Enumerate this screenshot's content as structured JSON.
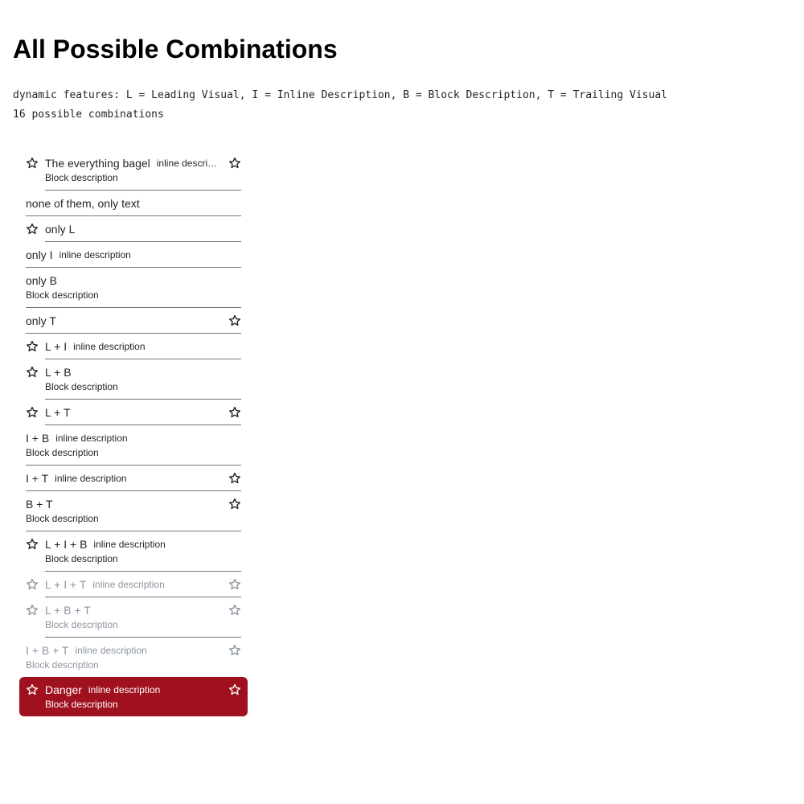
{
  "page": {
    "title": "All Possible Combinations",
    "features_line": "dynamic features: L = Leading Visual, I = Inline Description, B = Block Description, T = Trailing Visual",
    "combinations_line": "16 possible combinations"
  },
  "colors": {
    "text": "#1f2328",
    "divider": "#6e7781",
    "disabled": "#8c959f",
    "danger_bg": "#a0111f",
    "danger_text": "#ffffff"
  },
  "icons": {
    "leading": "star-icon",
    "trailing": "star-icon"
  },
  "items": [
    {
      "label": "The everything bagel",
      "inline": "inline description",
      "block": "Block description",
      "leading": true,
      "trailing": true,
      "state": "normal"
    },
    {
      "label": "none of them, only text",
      "inline": "",
      "block": "",
      "leading": false,
      "trailing": false,
      "state": "normal"
    },
    {
      "label": "only L",
      "inline": "",
      "block": "",
      "leading": true,
      "trailing": false,
      "state": "normal"
    },
    {
      "label": "only I",
      "inline": "inline description",
      "block": "",
      "leading": false,
      "trailing": false,
      "state": "normal"
    },
    {
      "label": "only B",
      "inline": "",
      "block": "Block description",
      "leading": false,
      "trailing": false,
      "state": "normal"
    },
    {
      "label": "only T",
      "inline": "",
      "block": "",
      "leading": false,
      "trailing": true,
      "state": "normal"
    },
    {
      "label": "L + I",
      "inline": "inline description",
      "block": "",
      "leading": true,
      "trailing": false,
      "state": "normal"
    },
    {
      "label": "L + B",
      "inline": "",
      "block": "Block description",
      "leading": true,
      "trailing": false,
      "state": "normal"
    },
    {
      "label": "L + T",
      "inline": "",
      "block": "",
      "leading": true,
      "trailing": true,
      "state": "normal"
    },
    {
      "label": "I + B",
      "inline": "inline description",
      "block": "Block description",
      "leading": false,
      "trailing": false,
      "state": "normal"
    },
    {
      "label": "I + T",
      "inline": "inline description",
      "block": "",
      "leading": false,
      "trailing": true,
      "state": "normal"
    },
    {
      "label": "B + T",
      "inline": "",
      "block": "Block description",
      "leading": false,
      "trailing": true,
      "state": "normal"
    },
    {
      "label": "L + I + B",
      "inline": "inline description",
      "block": "Block description",
      "leading": true,
      "trailing": false,
      "state": "normal"
    },
    {
      "label": "L + I + T",
      "inline": "inline description",
      "block": "",
      "leading": true,
      "trailing": true,
      "state": "disabled"
    },
    {
      "label": "L + B + T",
      "inline": "",
      "block": "Block description",
      "leading": true,
      "trailing": true,
      "state": "disabled"
    },
    {
      "label": "I + B + T",
      "inline": "inline description",
      "block": "Block description",
      "leading": false,
      "trailing": true,
      "state": "disabled"
    },
    {
      "label": "Danger",
      "inline": "inline description",
      "block": "Block description",
      "leading": true,
      "trailing": true,
      "state": "danger"
    }
  ]
}
